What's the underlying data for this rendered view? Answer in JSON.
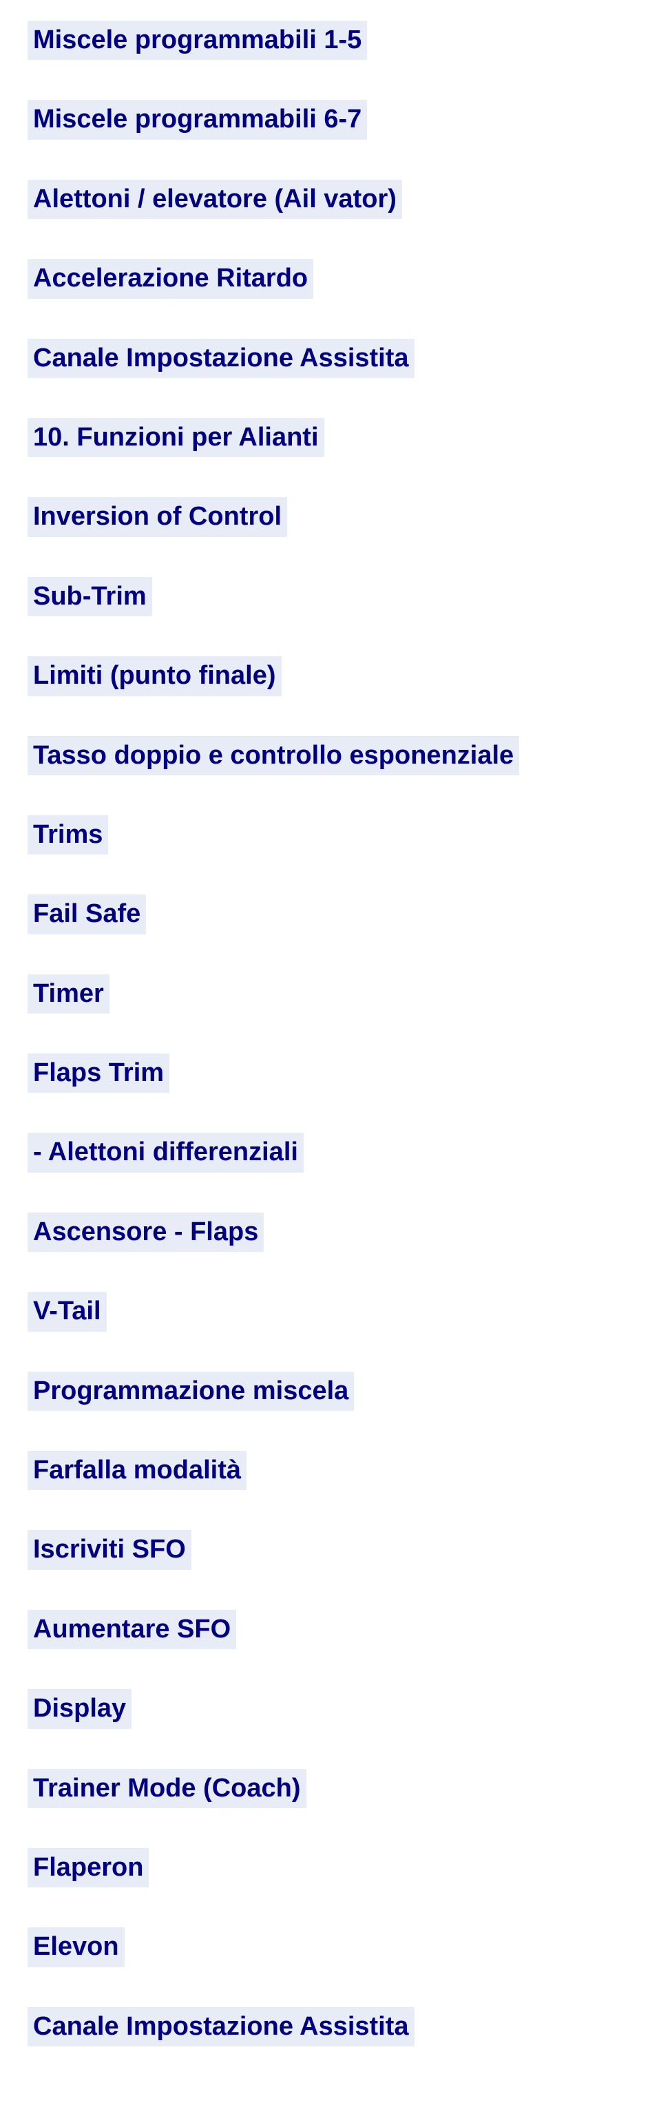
{
  "items": [
    "Miscele programmabili 1-5",
    "Miscele programmabili 6-7",
    "Alettoni / elevatore (Ail vator)",
    "Accelerazione Ritardo",
    "Canale Impostazione Assistita",
    "10. Funzioni per Alianti",
    "Inversion of Control",
    "Sub-Trim",
    "Limiti (punto finale)",
    "Tasso doppio e controllo esponenziale",
    "Trims",
    "Fail Safe",
    "Timer",
    "Flaps Trim",
    "- Alettoni differenziali",
    "Ascensore - Flaps",
    "V-Tail",
    "Programmazione miscela",
    "Farfalla modalità",
    "Iscriviti SFO",
    "Aumentare SFO",
    "Display",
    "Trainer Mode (Coach)",
    "Flaperon",
    "Elevon",
    "Canale Impostazione Assistita"
  ]
}
